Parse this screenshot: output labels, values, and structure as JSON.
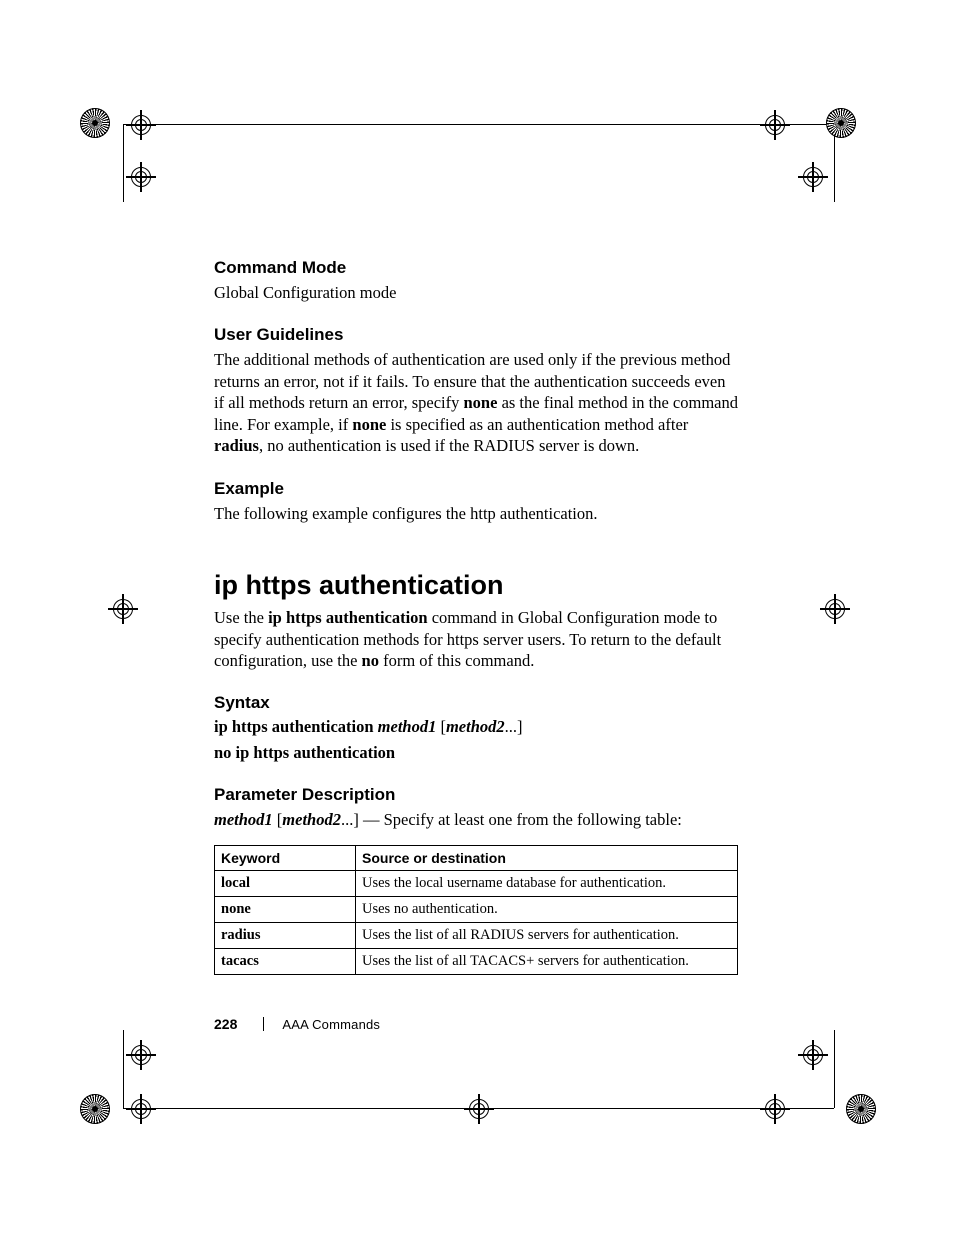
{
  "sections": {
    "commandMode": {
      "heading": "Command Mode",
      "body": "Global Configuration mode"
    },
    "userGuidelines": {
      "heading": "User Guidelines",
      "body_parts": [
        "The additional methods of authentication are used only if the previous method returns an error, not if it fails. To ensure that the authentication succeeds even if all methods return an error, specify ",
        "none",
        " as the final method in the command line. For example, if ",
        "none",
        " is specified as an authentication method after ",
        "radius",
        ", no authentication is used if the RADIUS server is down."
      ]
    },
    "example": {
      "heading": "Example",
      "body": "The following example configures the http authentication."
    }
  },
  "command": {
    "title": "ip https authentication",
    "intro_parts": [
      "Use the ",
      "ip https authentication",
      " command in Global Configuration mode to specify authentication methods for https server users. To return to the default configuration, use the ",
      "no",
      " form of this command."
    ],
    "syntax": {
      "heading": "Syntax",
      "line1": {
        "cmd": "ip https authentication ",
        "m1": "method1",
        "open": " [",
        "m2": "method2",
        "tail": "...]"
      },
      "line2": "no ip https authentication"
    },
    "paramDesc": {
      "heading": "Parameter Description",
      "lead": {
        "m1": "method1",
        "open": " [",
        "m2": "method2",
        "tail": "...] — Specify at least one from the following table:"
      },
      "table": {
        "headers": [
          "Keyword",
          "Source or destination"
        ],
        "rows": [
          {
            "k": "local",
            "d": "Uses the local username database for authentication."
          },
          {
            "k": "none",
            "d": "Uses no authentication."
          },
          {
            "k": "radius",
            "d": "Uses the list of all RADIUS servers for authentication."
          },
          {
            "k": "tacacs",
            "d": "Uses the list of all TACACS+ servers for authentication."
          }
        ]
      }
    }
  },
  "footer": {
    "pageNumber": "228",
    "chapter": "AAA Commands"
  }
}
